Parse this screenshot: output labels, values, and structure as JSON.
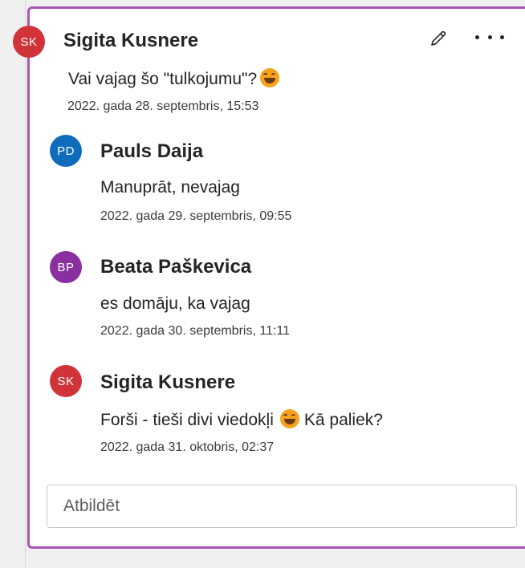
{
  "thread": {
    "root": {
      "author": "Sigita Kusnere",
      "initials": "SK",
      "message": "Vai vajag šo \"tulkojumu\"?",
      "has_emoji": true,
      "timestamp": "2022. gada 28. septembris, 15:53"
    },
    "replies": [
      {
        "author": "Pauls Daija",
        "initials": "PD",
        "message": "Manuprāt, nevajag",
        "timestamp": "2022. gada 29. septembris, 09:55"
      },
      {
        "author": "Beata Paškevica",
        "initials": "BP",
        "message": "es domāju, ka vajag",
        "timestamp": "2022. gada 30. septembris, 11:11"
      },
      {
        "author": "Sigita Kusnere",
        "initials": "SK",
        "message_before_emoji": "Forši - tieši divi viedokļi",
        "message_after_emoji": "Kā paliek?",
        "timestamp": "2022. gada 31. oktobris, 02:37"
      }
    ]
  },
  "actions": {
    "edit_icon": "pencil-icon",
    "more_icon": "more-options-icon"
  },
  "reply": {
    "placeholder": "Atbildēt",
    "value": ""
  },
  "colors": {
    "card_border": "#a855b5",
    "avatar_sk": "#d13438",
    "avatar_pd": "#0f6cbd",
    "avatar_bp": "#8a2fa0",
    "emoji": "#f7a21d"
  }
}
